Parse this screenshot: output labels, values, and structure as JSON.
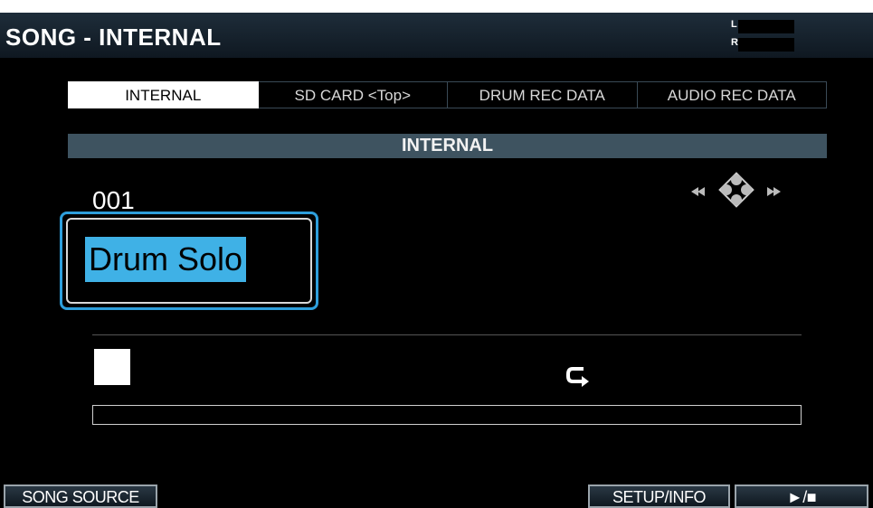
{
  "header": {
    "title": "SONG - INTERNAL",
    "meter_left": "L",
    "meter_right": "R"
  },
  "tabs": [
    {
      "label": "INTERNAL",
      "active": true
    },
    {
      "label": "SD CARD <Top>",
      "active": false
    },
    {
      "label": "DRUM REC DATA",
      "active": false
    },
    {
      "label": "AUDIO REC DATA",
      "active": false
    }
  ],
  "section": {
    "label": "INTERNAL"
  },
  "song": {
    "number": "001",
    "name": "Drum Solo"
  },
  "playback": {
    "state_icon": "stop-icon",
    "loop_icon": "loop-icon",
    "progress": 0
  },
  "function_keys": {
    "f1": "SONG SOURCE",
    "f4": "SETUP/INFO",
    "f5": "►/■"
  },
  "colors": {
    "accent": "#2e9fdc",
    "selection": "#3fb1e6",
    "section_bar": "#3e5360"
  }
}
